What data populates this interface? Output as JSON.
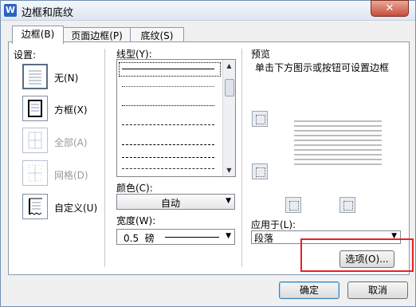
{
  "window": {
    "title": "边框和底纹",
    "app_icon_letter": "W",
    "close_symbol": "✕"
  },
  "tabs": [
    {
      "label": "边框(B)"
    },
    {
      "label": "页面边框(P)"
    },
    {
      "label": "底纹(S)"
    }
  ],
  "settings": {
    "label": "设置:",
    "items": [
      {
        "label": "无(N)"
      },
      {
        "label": "方框(X)"
      },
      {
        "label": "全部(A)"
      },
      {
        "label": "网格(D)"
      },
      {
        "label": "自定义(U)"
      }
    ]
  },
  "style": {
    "label": "线型(Y):",
    "options": [
      "solid",
      "dotted-fine",
      "dotted",
      "dashed-small",
      "dashed",
      "dash-dot",
      "dash-dot-dot"
    ]
  },
  "color": {
    "label": "颜色(C):",
    "value": "自动",
    "arrow": "▼"
  },
  "width": {
    "label": "宽度(W):",
    "value": "0.5  磅",
    "arrow": "▼"
  },
  "preview": {
    "label": "预览",
    "hint": "单击下方图示或按钮可设置边框"
  },
  "apply_to": {
    "label": "应用于(L):",
    "value": "段落",
    "arrow": "▼"
  },
  "buttons": {
    "options": "选项(O)...",
    "ok": "确定",
    "cancel": "取消"
  },
  "highlight_color": "#e8202a"
}
